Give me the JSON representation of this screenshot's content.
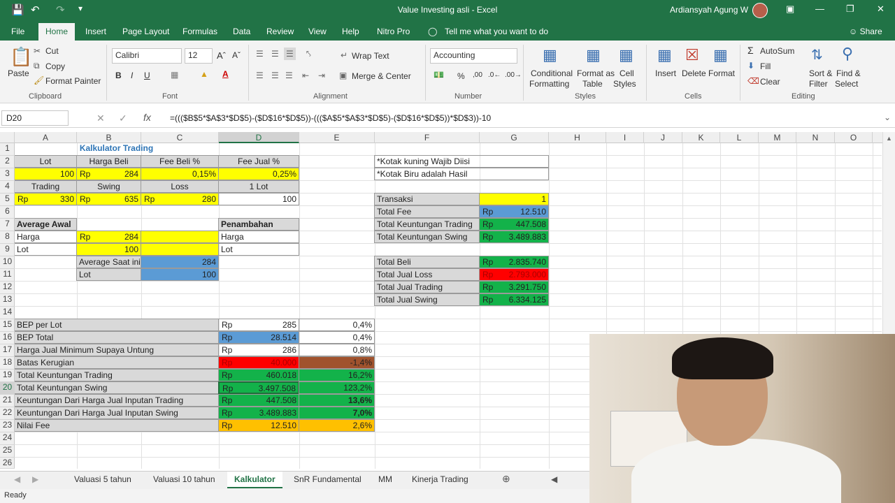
{
  "window": {
    "title": "Value Investing asli  -  Excel",
    "user": "Ardiansyah Agung W"
  },
  "menu": {
    "tabs": [
      "File",
      "Home",
      "Insert",
      "Page Layout",
      "Formulas",
      "Data",
      "Review",
      "View",
      "Help",
      "Nitro Pro"
    ],
    "tellme": "Tell me what you want to do",
    "share": "Share"
  },
  "ribbon": {
    "clipboard": {
      "paste": "Paste",
      "cut": "Cut",
      "copy": "Copy",
      "format_painter": "Format Painter",
      "label": "Clipboard"
    },
    "font": {
      "name": "Calibri",
      "size": "12",
      "label": "Font"
    },
    "alignment": {
      "wrap": "Wrap Text",
      "merge": "Merge & Center",
      "label": "Alignment"
    },
    "number": {
      "format": "Accounting",
      "label": "Number"
    },
    "styles": {
      "cond": "Conditional",
      "cond2": "Formatting",
      "fmt_table": "Format as",
      "fmt_table2": "Table",
      "cell_styles": "Cell",
      "cell_styles2": "Styles",
      "label": "Styles"
    },
    "cells": {
      "insert": "Insert",
      "delete": "Delete",
      "format": "Format",
      "label": "Cells"
    },
    "editing": {
      "autosum": "AutoSum",
      "fill": "Fill",
      "clear": "Clear",
      "sort": "Sort &",
      "sort2": "Filter",
      "find": "Find &",
      "find2": "Select",
      "label": "Editing"
    }
  },
  "formula_bar": {
    "cell": "D20",
    "formula": "=((($B$5*$A$3*$D$5)-($D$16*$D$5))-((($A$5*$A$3*$D$5)-($D$16*$D$5))*$D$3))-10"
  },
  "columns": [
    "A",
    "B",
    "C",
    "D",
    "E",
    "F",
    "G",
    "H",
    "I",
    "J",
    "K",
    "L",
    "M",
    "N",
    "O"
  ],
  "rows": [
    "1",
    "2",
    "3",
    "4",
    "5",
    "6",
    "7",
    "8",
    "9",
    "10",
    "11",
    "12",
    "13",
    "14",
    "15",
    "16",
    "17",
    "18",
    "19",
    "20",
    "21",
    "22",
    "23",
    "24",
    "25",
    "26"
  ],
  "cells": {
    "b1": "Kalkulator Trading",
    "a2": "Lot",
    "b2": "Harga Beli",
    "c2": "Fee Beli %",
    "d2": "Fee Jual %",
    "a3": "100",
    "b3": "284",
    "c3": "0,15%",
    "d3": "0,25%",
    "a4": "Trading",
    "b4": "Swing",
    "c4": "Loss",
    "d4": "1 Lot",
    "a5": "330",
    "b5": "635",
    "c5": "280",
    "d5": "100",
    "a7": "Average Awal",
    "d7": "Penambahan",
    "a8": "Harga",
    "b8": "284",
    "d8": "Harga",
    "a9": "Lot",
    "b9": "100",
    "d9": "Lot",
    "b10": "Average Saat ini",
    "c10": "284",
    "b11": "Lot",
    "c11": "100",
    "a15": "BEP per Lot",
    "d15": "285",
    "e15": "0,4%",
    "a16": "BEP Total",
    "d16": "28.514",
    "e16": "0,4%",
    "a17": "Harga Jual Minimum Supaya Untung",
    "d17": "286",
    "e17": "0,8%",
    "a18": "Batas Kerugian",
    "d18": "40.000",
    "e18": "-1,4%",
    "a19": "Total Keuntungan Trading",
    "d19": "460.018",
    "e19": "16,2%",
    "a20": "Total Keuntungan Swing",
    "d20": "3.497.508",
    "e20": "123,2%",
    "a21": "Keuntungan Dari Harga Jual Inputan Trading",
    "d21": "447.508",
    "e21": "13,6%",
    "a22": "Keuntungan Dari Harga Jual Inputan Swing",
    "d22": "3.489.883",
    "e22": "7,0%",
    "a23": "Nilai Fee",
    "d23": "12.510",
    "e23": "2,6%",
    "f2": "*Kotak kuning Wajib Diisi",
    "f3": "*Kotak Biru adalah Hasil",
    "f5": "Transaksi",
    "g5": "1",
    "f6": "Total Fee",
    "g6": "12.510",
    "f7": "Total Keuntungan Trading",
    "g7": "447.508",
    "f8": "Total Keuntungan Swing",
    "g8": "3.489.883",
    "f10": "Total Beli",
    "g10": "2.835.740",
    "f11": "Total Jual Loss",
    "g11": "2.793.000",
    "f12": "Total Jual Trading",
    "g12": "3.291.750",
    "f13": "Total Jual Swing",
    "g13": "6.334.125",
    "rp": "Rp"
  },
  "sheets": [
    "Valuasi 5 tahun",
    "Valuasi 10 tahun",
    "Kalkulator",
    "SnR Fundamental",
    "MM",
    "Kinerja Trading"
  ],
  "status": "Ready",
  "colors": {
    "excel_green": "#217346",
    "yellow": "#ffff00",
    "blue": "#5b9bd5",
    "green": "#13b24a",
    "red": "#ff0000",
    "orange": "#ffc000",
    "brown": "#a0522d"
  }
}
